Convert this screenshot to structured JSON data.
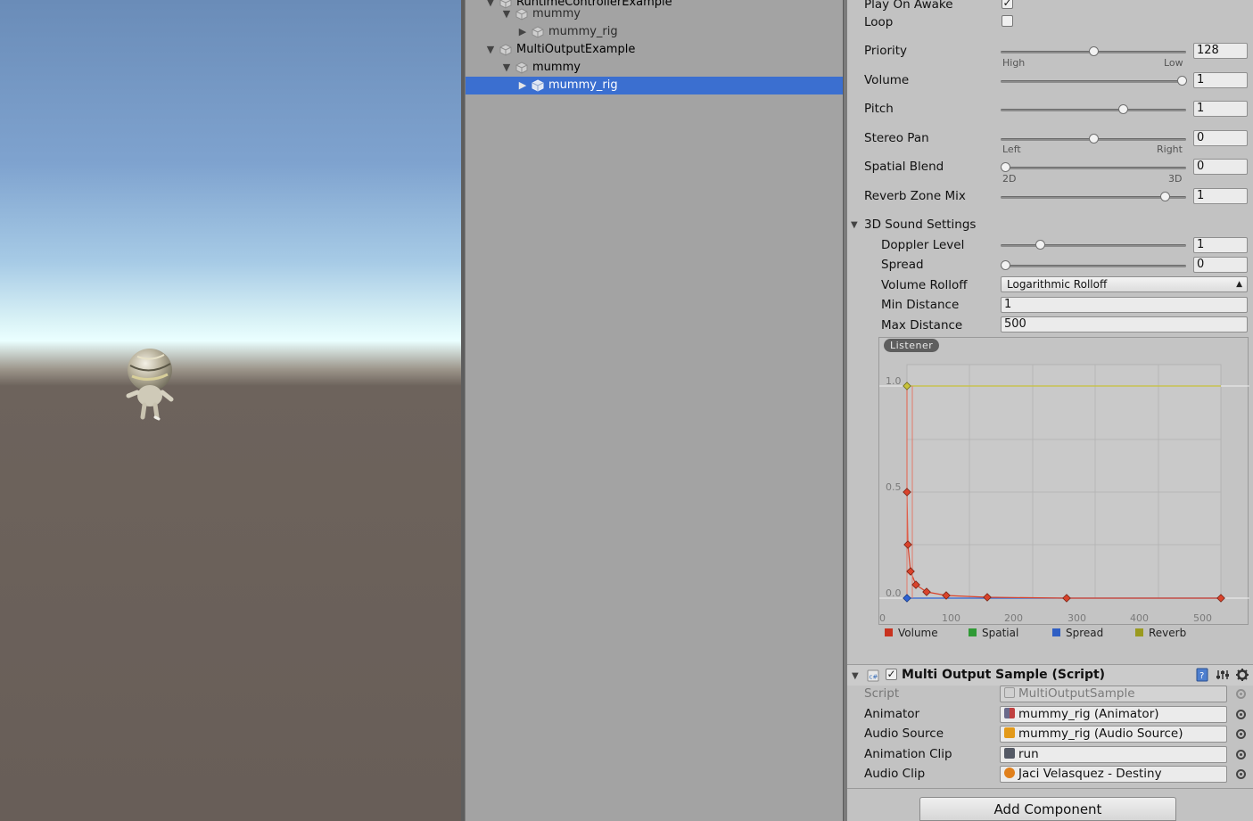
{
  "hierarchy": {
    "rows": [
      {
        "label": "RuntimeControllerExample",
        "indent": 1,
        "arrow": "▼",
        "selected": false,
        "prefab": false
      },
      {
        "label": "mummy",
        "indent": 2,
        "arrow": "▼",
        "selected": false,
        "prefab": true
      },
      {
        "label": "mummy_rig",
        "indent": 3,
        "arrow": "▶",
        "selected": false,
        "prefab": true
      },
      {
        "label": "MultiOutputExample",
        "indent": 1,
        "arrow": "▼",
        "selected": false,
        "prefab": false
      },
      {
        "label": "mummy",
        "indent": 2,
        "arrow": "▼",
        "selected": false,
        "prefab": false
      },
      {
        "label": "mummy_rig",
        "indent": 3,
        "arrow": "▶",
        "selected": true,
        "prefab": false
      }
    ]
  },
  "audio_source": {
    "play_on_awake": {
      "label": "Play On Awake",
      "checked": true
    },
    "loop": {
      "label": "Loop",
      "checked": false
    },
    "priority": {
      "label": "Priority",
      "value": "128",
      "fraction": 0.5,
      "left_hint": "High",
      "right_hint": "Low"
    },
    "volume": {
      "label": "Volume",
      "value": "1",
      "fraction": 1.0
    },
    "pitch": {
      "label": "Pitch",
      "value": "1",
      "fraction": 0.667
    },
    "stereo_pan": {
      "label": "Stereo Pan",
      "value": "0",
      "fraction": 0.5,
      "left_hint": "Left",
      "right_hint": "Right"
    },
    "spatial_blend": {
      "label": "Spatial Blend",
      "value": "0",
      "fraction": 0.0,
      "left_hint": "2D",
      "right_hint": "3D"
    },
    "reverb_zone_mix": {
      "label": "Reverb Zone Mix",
      "value": "1",
      "fraction": 0.909
    },
    "sound_3d": {
      "header": "3D Sound Settings",
      "doppler_level": {
        "label": "Doppler Level",
        "value": "1",
        "fraction": 0.2
      },
      "spread": {
        "label": "Spread",
        "value": "0",
        "fraction": 0.0
      },
      "volume_rolloff": {
        "label": "Volume Rolloff",
        "value": "Logarithmic Rolloff"
      },
      "min_distance": {
        "label": "Min Distance",
        "value": "1"
      },
      "max_distance": {
        "label": "Max Distance",
        "value": "500"
      }
    }
  },
  "curve_editor": {
    "listener_label": "Listener",
    "y_ticks": [
      "1.0",
      "0.5",
      "0.0"
    ],
    "x_ticks": [
      "0",
      "100",
      "200",
      "300",
      "400",
      "500"
    ],
    "legend": [
      {
        "name": "Volume",
        "color": "#c8321f"
      },
      {
        "name": "Spatial",
        "color": "#2f9a35"
      },
      {
        "name": "Spread",
        "color": "#2f5fc4"
      },
      {
        "name": "Reverb",
        "color": "#9a9a1f"
      }
    ],
    "colors": {
      "volume": "#d9432b",
      "reverb": "#c8c23a",
      "spread": "#2f63d4"
    }
  },
  "component": {
    "title": "Multi Output Sample (Script)",
    "enabled": true,
    "fields": [
      {
        "label": "Script",
        "value": "MultiOutputSample",
        "icon": "script-icon",
        "readonly": true
      },
      {
        "label": "Animator",
        "value": "mummy_rig (Animator)",
        "icon": "animator-icon",
        "readonly": false
      },
      {
        "label": "Audio Source",
        "value": "mummy_rig (Audio Source)",
        "icon": "audio-source-icon",
        "readonly": false
      },
      {
        "label": "Animation Clip",
        "value": "run",
        "icon": "animation-clip-icon",
        "readonly": false
      },
      {
        "label": "Audio Clip",
        "value": "Jaci Velasquez - Destiny",
        "icon": "audio-clip-icon",
        "readonly": false
      }
    ]
  },
  "add_component_label": "Add Component"
}
